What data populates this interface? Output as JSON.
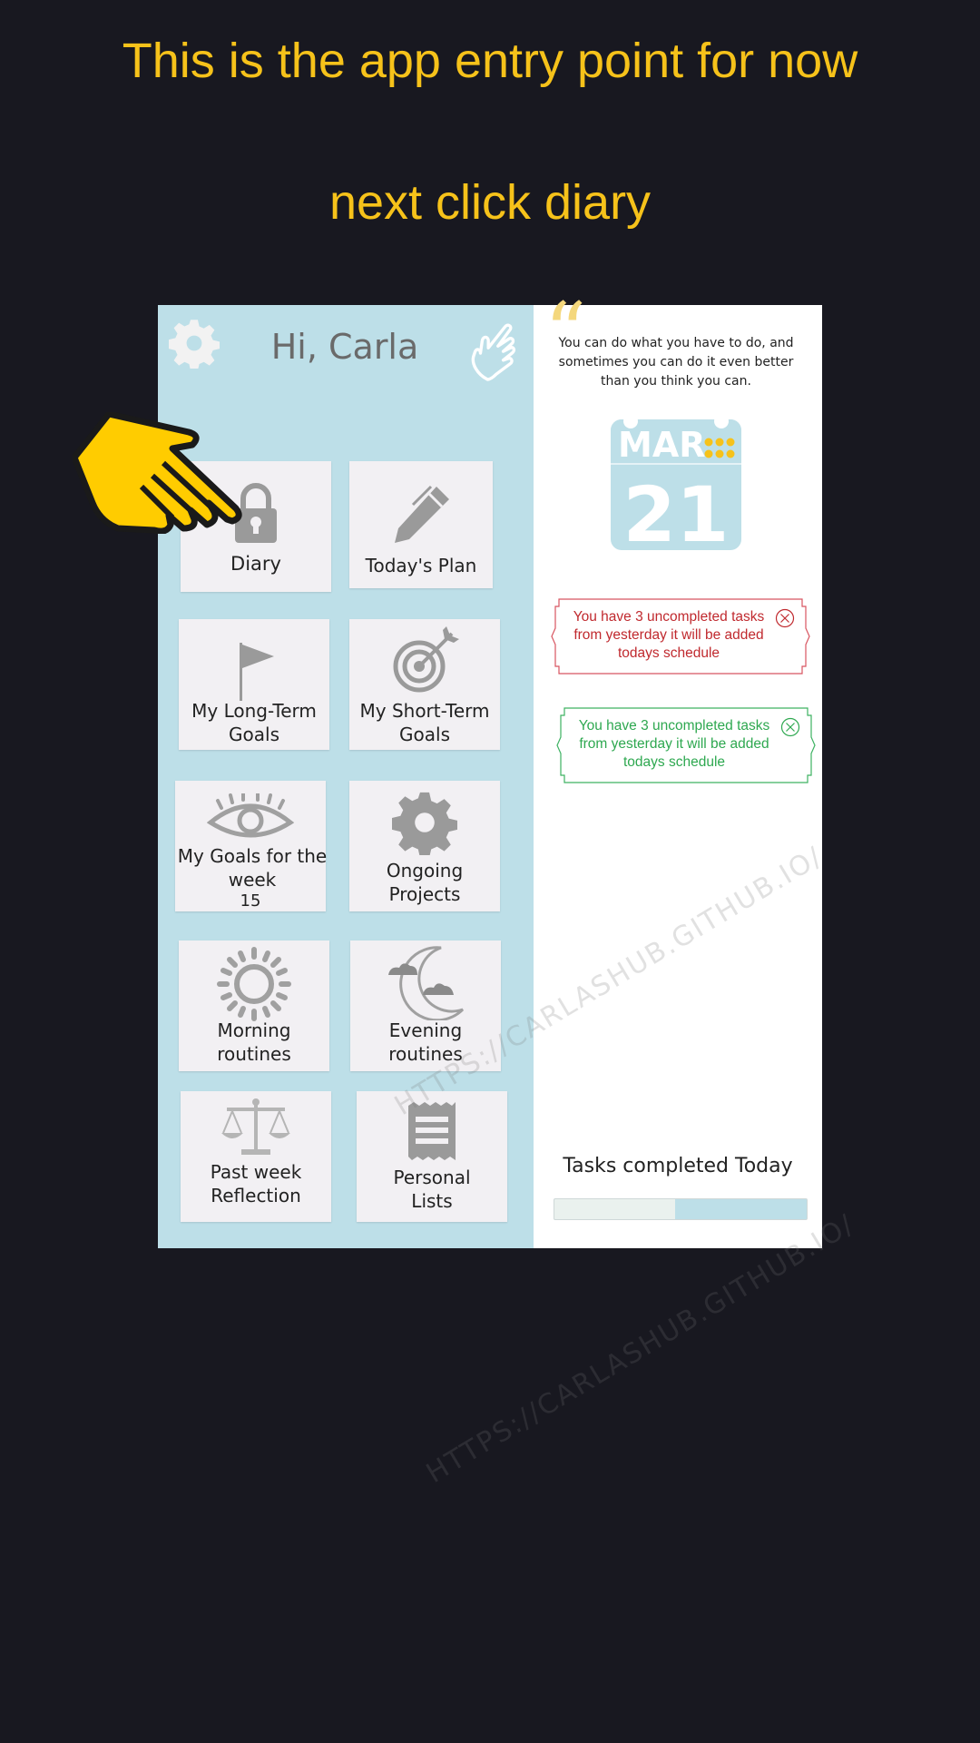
{
  "captions": {
    "line1": "This is the app entry point for now",
    "line2": "next click diary"
  },
  "greeting": "Hi, Carla",
  "tiles": [
    {
      "label": "Diary",
      "icon": "lock-icon"
    },
    {
      "label": "Today's Plan",
      "icon": "pencil-icon"
    },
    {
      "label": "My Long-Term Goals",
      "icon": "flag-icon"
    },
    {
      "label": "My Short-Term Goals",
      "icon": "target-icon"
    },
    {
      "label": "My Goals for the week",
      "icon": "eye-icon",
      "badge": "15"
    },
    {
      "label": "Ongoing Projects",
      "icon": "gear-icon"
    },
    {
      "label": "Morning routines",
      "icon": "sun-icon"
    },
    {
      "label": "Evening routines",
      "icon": "moon-icon"
    },
    {
      "label": "Past week Reflection",
      "icon": "scales-icon"
    },
    {
      "label": "Personal Lists",
      "icon": "list-icon"
    }
  ],
  "quote": "You can do what you have to do, and sometimes you can do it even better than you think you can.",
  "calendar": {
    "month": "MAR",
    "day": "21"
  },
  "notices": [
    {
      "text": "You have  3 uncompleted tasks from yesterday it will be added todays schedule",
      "color": "#C0292E"
    },
    {
      "text": "You have  3 uncompleted tasks from yesterday it will be added todays schedule",
      "color": "#2EA850"
    }
  ],
  "tasks": {
    "title": "Tasks completed Today",
    "progress": 0.48
  },
  "watermark": "HTTPS://CARLASHUB.GITHUB.IO/",
  "colors": {
    "caption": "#F6C21A",
    "panel": "#BDDFE8",
    "pointer": "#FFCC00"
  }
}
